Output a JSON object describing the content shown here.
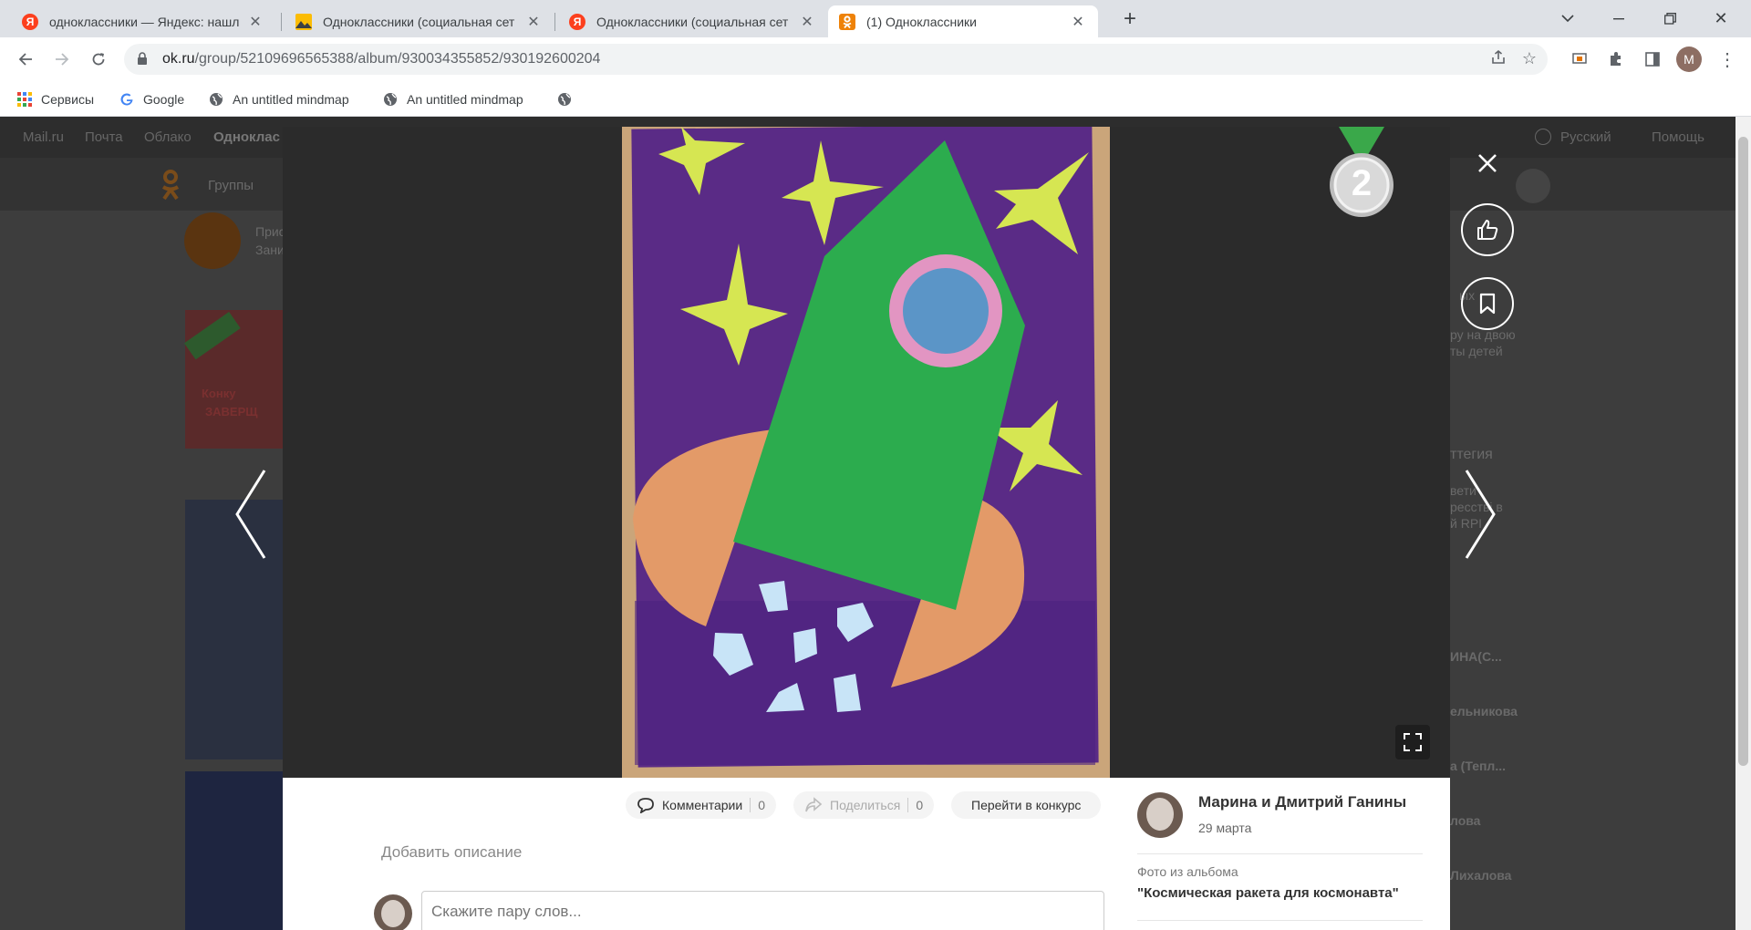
{
  "browser": {
    "tabs": [
      {
        "title": "одноклассники — Яндекс: нашл",
        "favicon": "yandex-icon",
        "active": false
      },
      {
        "title": "Одноклассники (социальная сет",
        "favicon": "image-icon",
        "active": false
      },
      {
        "title": "Одноклассники (социальная сет",
        "favicon": "yandex-icon",
        "active": false
      },
      {
        "title": "(1) Одноклассники",
        "favicon": "ok-icon",
        "active": true
      }
    ],
    "new_tab": "+",
    "url_host": "ok.ru",
    "url_path": "/group/52109696565388/album/930034355852/930192600204",
    "profile_initial": "M",
    "bookmarks": [
      {
        "label": "Сервисы",
        "icon": "apps-grid-icon"
      },
      {
        "label": "Google",
        "icon": "google-icon"
      },
      {
        "label": "An untitled mindmap",
        "icon": "globe-icon"
      },
      {
        "label": "An untitled mindmap",
        "icon": "globe-icon"
      },
      {
        "label": "",
        "icon": "globe-icon"
      }
    ]
  },
  "background_page": {
    "nav": [
      "Mail.ru",
      "Почта",
      "Облако",
      "Одноклас"
    ],
    "lang": "Русский",
    "help": "Помощь",
    "groups_link": "Группы",
    "side_texts": [
      "Прис",
      "Зани",
      "ых",
      "ру на двою",
      "ты детей",
      "ттегия",
      "вети",
      "ресстві в",
      "й RPI",
      "ИНА(С...",
      "ельникова",
      "а (Тепл...",
      "лова",
      "Лихалова",
      "Конку",
      "ЗАВЕРЩ"
    ]
  },
  "viewer": {
    "medal_number": "2",
    "comments_label": "Комментарии",
    "comments_count": "0",
    "share_label": "Поделиться",
    "share_count": "0",
    "contest_label": "Перейти в конкурс",
    "add_description": "Добавить описание",
    "comment_placeholder": "Скажите пару слов...",
    "author_name": "Марина и Дмитрий Ганины",
    "date": "29 марта",
    "album_caption": "Фото из альбома",
    "album_title": "\"Космическая ракета для космонавта\""
  },
  "colors": {
    "ok_orange": "#ee8208",
    "yandex_red": "#fc3f1d",
    "paper_purple": "#5a2b86",
    "rocket_green": "#2cac4e",
    "star_yellow": "#d6e652",
    "planet_orange": "#e39a68"
  }
}
